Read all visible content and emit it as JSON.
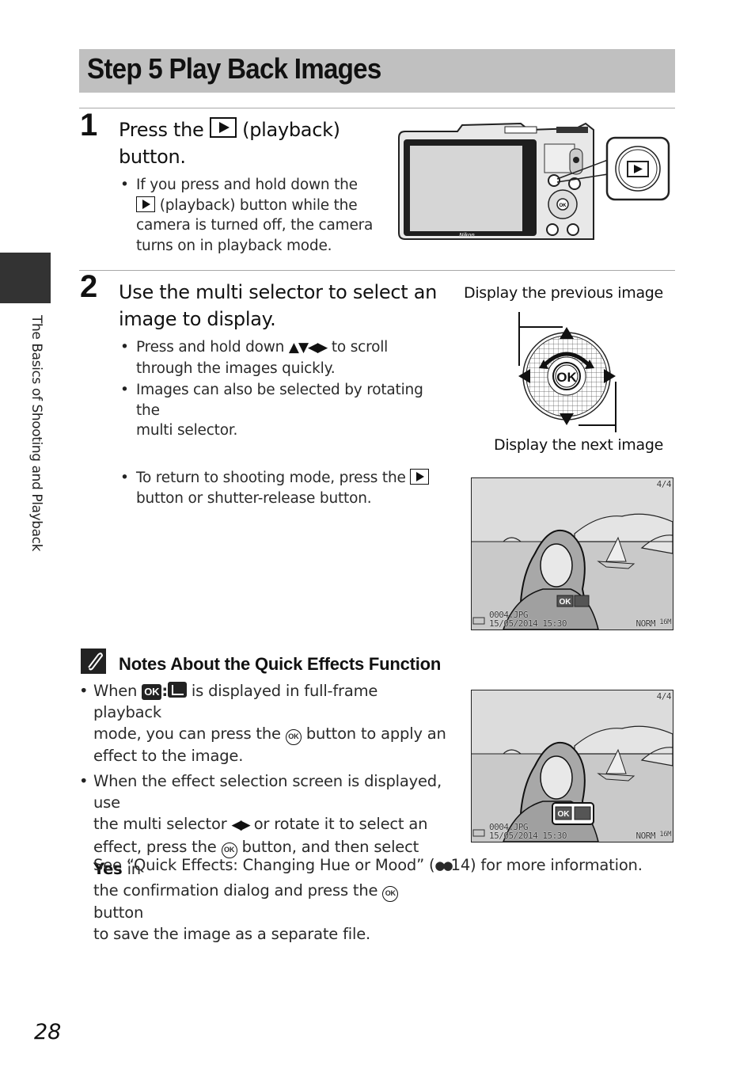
{
  "page": {
    "title": "Step 5 Play Back Images",
    "side_tab_label": "The Basics of Shooting and Playback",
    "page_number": "28"
  },
  "step1": {
    "number": "1",
    "heading_pre": "Press the",
    "heading_post": "(playback)",
    "heading_line2": "button.",
    "bullet1_l1": "If you press and hold down the",
    "bullet1_l2": "(playback) button while the",
    "bullet1_l3": "camera is turned off, the camera",
    "bullet1_l4": "turns on in playback mode.",
    "illustration": {
      "brand": "Nikon",
      "icon": "playback-button-icon"
    }
  },
  "step2": {
    "number": "2",
    "heading_l1": "Use the multi selector to select an",
    "heading_l2": "image to display.",
    "bullet1_pre": "Press and hold down",
    "bullet1_arrows": "▲▼◀▶",
    "bullet1_post": "to scroll",
    "bullet1_l2": "through the images quickly.",
    "bullet2_l1": "Images can also be selected by rotating the",
    "bullet2_l2": "multi selector.",
    "bullet3_l1": "To return to shooting mode, press the",
    "bullet3_l2": "button or shutter-release button.",
    "selector_caption_prev": "Display the previous image",
    "selector_caption_next": "Display the next image",
    "selector_ok": "OK"
  },
  "screen_osd": {
    "counter": "4/4",
    "filename": "0004.JPG",
    "datetime": "15/05/2014  15:30",
    "quality": "NORM",
    "size": "16M",
    "ok_hint": "OK"
  },
  "notes": {
    "heading": "Notes About the Quick Effects Function",
    "b1_pre": "When",
    "b1_ok": "OK",
    "b1_colon": ":",
    "b1_post": "is displayed in full-frame playback",
    "b1_l2_pre": "mode, you can press the",
    "b1_l2_post": "button to apply an",
    "b1_l3": "effect to the image.",
    "b2_l1": "When the effect selection screen is displayed, use",
    "b2_l2_pre": "the multi selector",
    "b2_l2_arrows": "◀▶",
    "b2_l2_post": "or rotate it to select an",
    "b2_l3_pre": "effect, press the",
    "b2_l3_mid": "button, and then select",
    "b2_l3_bold": "Yes",
    "b2_l3_post": "in",
    "b2_l4_pre": "the confirmation dialog and press the",
    "b2_l4_post": "button",
    "b2_l5": "to save the image as a separate file.",
    "see_also_pre": "See “Quick Effects: Changing Hue or Mood” (",
    "see_also_ref": "14",
    "see_also_post": ") for more information.",
    "ok_glyph": "OK"
  }
}
